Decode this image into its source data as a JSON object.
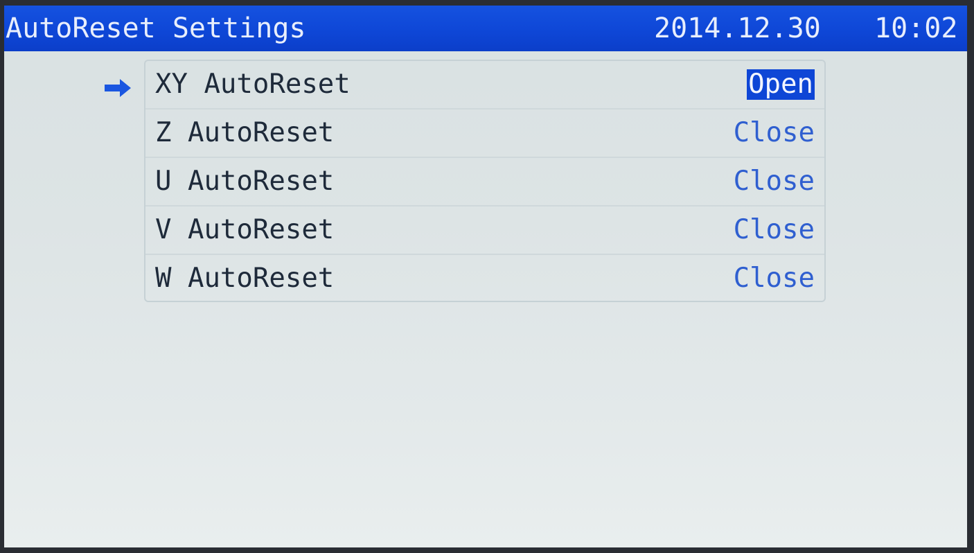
{
  "header": {
    "title": "AutoReset Settings",
    "date": "2014.12.30",
    "time": "10:02"
  },
  "selection_indicator": {
    "icon": "right-arrow-icon",
    "color": "#1a56e0"
  },
  "settings": [
    {
      "label": "XY AutoReset",
      "value": "Open",
      "selected": true
    },
    {
      "label": "Z AutoReset",
      "value": "Close",
      "selected": false
    },
    {
      "label": "U AutoReset",
      "value": "Close",
      "selected": false
    },
    {
      "label": "V AutoReset",
      "value": "Close",
      "selected": false
    },
    {
      "label": "W AutoReset",
      "value": "Close",
      "selected": false
    }
  ],
  "colors": {
    "header_bg": "#0e46d6",
    "value_text": "#2f5fd0",
    "label_text": "#1e2a3a",
    "screen_bg": "#dde4e5"
  }
}
